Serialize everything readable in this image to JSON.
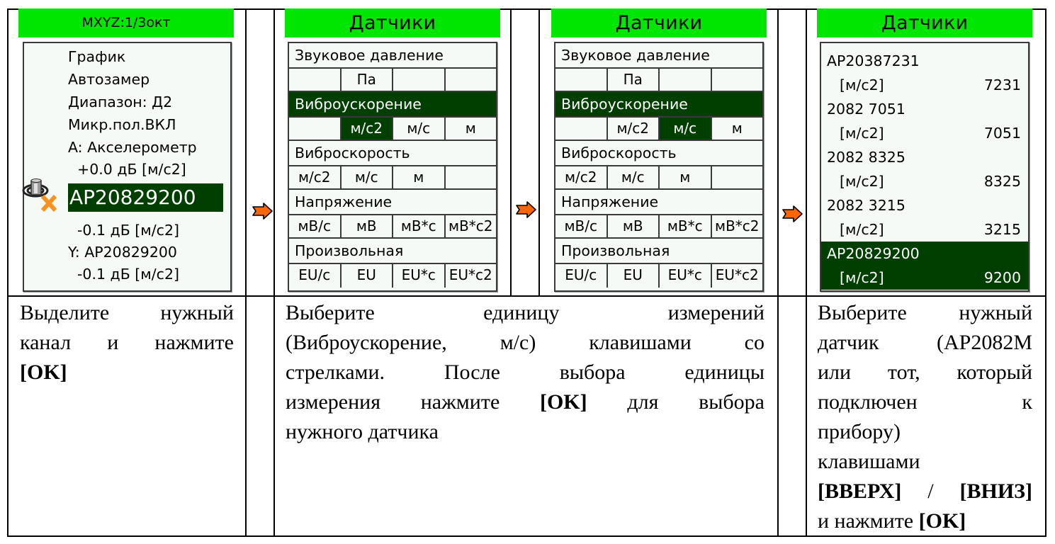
{
  "screens": [
    {
      "header": "MXYZ:1/3окт",
      "lines": [
        "График",
        "Автозамер",
        "Диапазон: Д2",
        "Микр.пол.ВКЛ",
        "A: Акселерометр",
        "  +0.0 дБ [м/с2]"
      ],
      "selected_sensor": "AP20829200",
      "lines_after": [
        "  -0.1 дБ [м/с2]",
        "Y: AP20829200",
        "  -0.1 дБ [м/с2]"
      ],
      "icon": "sensor-disconnected-icon"
    },
    {
      "header": "Датчики",
      "groups": [
        {
          "title": "Звуковое давление",
          "units": [
            "",
            "Па",
            "",
            ""
          ],
          "selected": false,
          "selected_unit": null
        },
        {
          "title": "Виброускорение",
          "units": [
            "",
            "м/с2",
            "м/с",
            "м"
          ],
          "selected": true,
          "selected_unit": 1
        },
        {
          "title": "Виброскорость",
          "units": [
            "м/с2",
            "м/с",
            "м",
            ""
          ],
          "selected": false,
          "selected_unit": null
        },
        {
          "title": "Напряжение",
          "units": [
            "мВ/с",
            "мВ",
            "мВ*с",
            "мВ*с2"
          ],
          "selected": false,
          "selected_unit": null
        },
        {
          "title": "Произвольная",
          "units": [
            "EU/c",
            "EU",
            "EU*c",
            "EU*c2"
          ],
          "selected": false,
          "selected_unit": null
        }
      ]
    },
    {
      "header": "Датчики",
      "groups": [
        {
          "title": "Звуковое давление",
          "units": [
            "",
            "Па",
            "",
            ""
          ],
          "selected": false,
          "selected_unit": null
        },
        {
          "title": "Виброускорение",
          "units": [
            "",
            "м/с2",
            "м/с",
            "м"
          ],
          "selected": true,
          "selected_unit": 2
        },
        {
          "title": "Виброскорость",
          "units": [
            "м/с2",
            "м/с",
            "м",
            ""
          ],
          "selected": false,
          "selected_unit": null
        },
        {
          "title": "Напряжение",
          "units": [
            "мВ/с",
            "мВ",
            "мВ*с",
            "мВ*с2"
          ],
          "selected": false,
          "selected_unit": null
        },
        {
          "title": "Произвольная",
          "units": [
            "EU/c",
            "EU",
            "EU*c",
            "EU*c2"
          ],
          "selected": false,
          "selected_unit": null
        }
      ]
    },
    {
      "header": "Датчики",
      "sensors": [
        {
          "name": "AP20387231",
          "unit": "[м/с2]",
          "code": "7231",
          "selected": false
        },
        {
          "name": "2082 7051",
          "unit": "[м/с2]",
          "code": "7051",
          "selected": false
        },
        {
          "name": "2082 8325",
          "unit": "[м/с2]",
          "code": "8325",
          "selected": false
        },
        {
          "name": "2082 3215",
          "unit": "[м/с2]",
          "code": "3215",
          "selected": false
        },
        {
          "name": "AP20829200",
          "unit": "[м/с2]",
          "code": "9200",
          "selected": true
        }
      ]
    }
  ],
  "instructions": [
    {
      "lines": [
        [
          {
            "t": "Выделите нужный"
          }
        ],
        [
          {
            "t": "канал и нажмите"
          }
        ],
        [
          {
            "t": "[OK]",
            "b": true
          }
        ]
      ]
    },
    {
      "lines": [
        [
          {
            "t": "Выберите единицу измерений"
          }
        ],
        [
          {
            "t": "(Виброускорение, м/с) клавишами со"
          }
        ],
        [
          {
            "t": "стрелками. После выбора единицы"
          }
        ],
        [
          {
            "t": "измерения нажмите "
          },
          {
            "t": "[OK]",
            "b": true
          },
          {
            "t": " для выбора"
          }
        ],
        [
          {
            "t": "нужного датчика"
          }
        ]
      ]
    },
    {
      "lines": [
        [
          {
            "t": "Выберите нужный"
          }
        ],
        [
          {
            "t": "датчик (AP2082M"
          }
        ],
        [
          {
            "t": "или тот, который"
          }
        ],
        [
          {
            "t": "подключен к"
          }
        ],
        [
          {
            "t": "прибору)"
          }
        ],
        [
          {
            "t": "клавишами"
          }
        ],
        [
          {
            "t": "[ВВЕРХ]",
            "b": true
          },
          {
            "t": " / "
          },
          {
            "t": "[ВНИЗ]",
            "b": true
          }
        ],
        [
          {
            "t": "и нажмите "
          },
          {
            "t": "[OK]",
            "b": true
          }
        ]
      ]
    }
  ],
  "arrows": [
    "arrow-right-icon",
    "arrow-right-icon",
    "arrow-right-icon"
  ],
  "colors": {
    "header_green": "#00e600",
    "selection_dark_green": "#003f00",
    "screen_bg": "#f6faf6",
    "arrow_orange": "#ff6600"
  }
}
